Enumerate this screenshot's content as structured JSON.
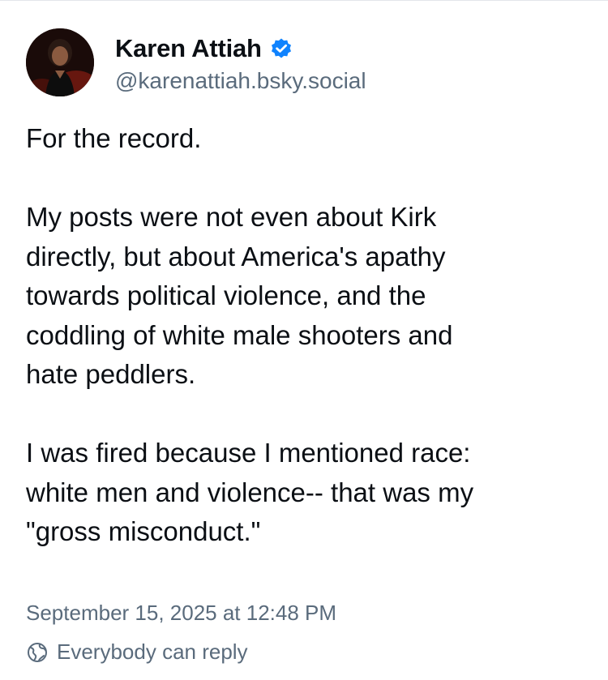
{
  "author": {
    "display_name": "Karen Attiah",
    "handle": "@karenattiah.bsky.social",
    "verified": true,
    "icons": {
      "avatar": "avatar",
      "verified": "verified-check-icon"
    },
    "colors": {
      "verified": "#1083fe"
    }
  },
  "post": {
    "paragraphs": [
      [
        "For the record."
      ],
      [
        "My posts were not even about Kirk",
        "directly, but about America's apathy",
        "towards political violence, and the",
        "coddling of white male shooters and",
        "hate peddlers."
      ],
      [
        "I was fired because I mentioned race:",
        "white men and violence-- that was my",
        "\"gross misconduct.\""
      ]
    ],
    "timestamp": "September 15, 2025 at 12:48 PM",
    "reply_setting": "Everybody can reply",
    "reply_icon": "globe-icon"
  }
}
